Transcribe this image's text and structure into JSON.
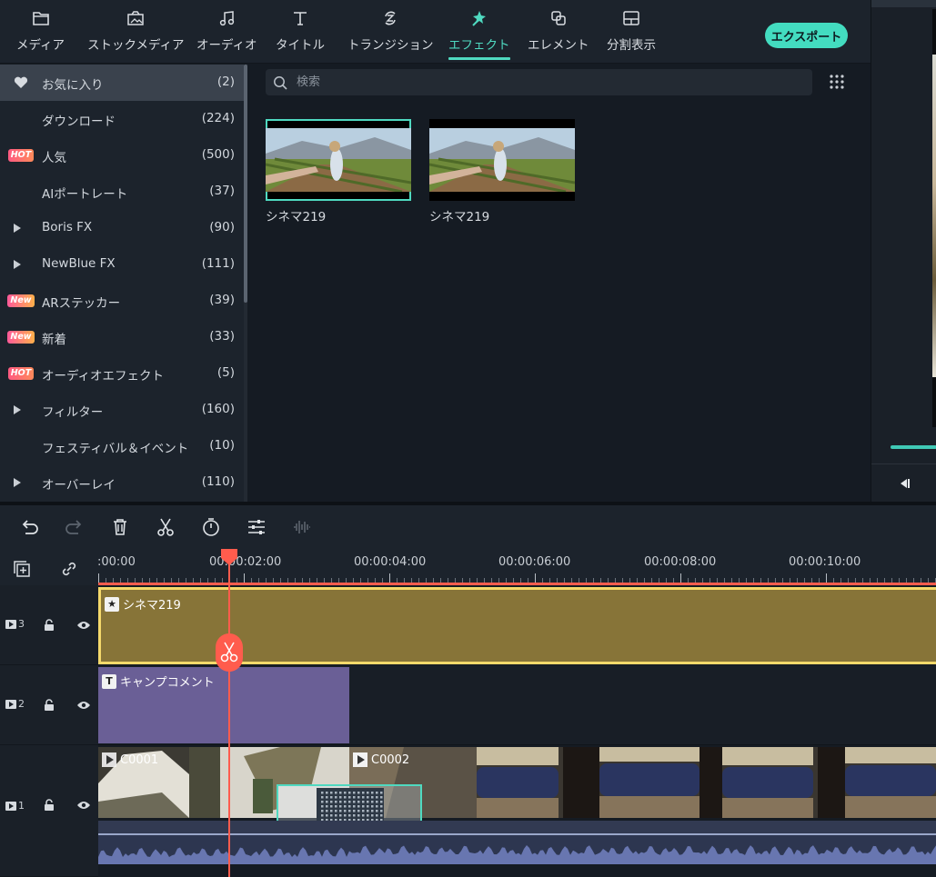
{
  "tabs": [
    {
      "label": "メディア",
      "icon": "folder-icon"
    },
    {
      "label": "ストックメディア",
      "icon": "stock-media-icon"
    },
    {
      "label": "オーディオ",
      "icon": "music-note-icon"
    },
    {
      "label": "タイトル",
      "icon": "title-t-icon"
    },
    {
      "label": "トランジション",
      "icon": "transition-icon"
    },
    {
      "label": "エフェクト",
      "icon": "effects-icon"
    },
    {
      "label": "エレメント",
      "icon": "elements-icon"
    },
    {
      "label": "分割表示",
      "icon": "split-screen-icon"
    }
  ],
  "active_tab": "エフェクト",
  "export_label": "エクスポート",
  "sidebar": {
    "items": [
      {
        "label": "お気に入り",
        "count": "(2)",
        "lead": "heart-icon",
        "selected": true
      },
      {
        "label": "ダウンロード",
        "count": "(224)",
        "lead": ""
      },
      {
        "label": "人気",
        "count": "(500)",
        "lead": "HOT"
      },
      {
        "label": "AIポートレート",
        "count": "(37)",
        "lead": ""
      },
      {
        "label": "Boris FX",
        "count": "(90)",
        "lead": "expand-arrow-icon"
      },
      {
        "label": "NewBlue FX",
        "count": "(111)",
        "lead": "expand-arrow-icon"
      },
      {
        "label": "ARステッカー",
        "count": "(39)",
        "lead": "New"
      },
      {
        "label": "新着",
        "count": "(33)",
        "lead": "New"
      },
      {
        "label": "オーディオエフェクト",
        "count": "(5)",
        "lead": "HOT"
      },
      {
        "label": "フィルター",
        "count": "(160)",
        "lead": "expand-arrow-icon"
      },
      {
        "label": "フェスティバル＆イベント",
        "count": "(10)",
        "lead": ""
      },
      {
        "label": "オーバーレイ",
        "count": "(110)",
        "lead": "expand-arrow-icon"
      }
    ]
  },
  "search": {
    "placeholder": "検索"
  },
  "effects": [
    {
      "title": "シネマ219",
      "selected": true
    },
    {
      "title": "シネマ219",
      "selected": false
    }
  ],
  "timeline": {
    "timecodes": [
      ":00:00",
      "00:00:02:00",
      "00:00:04:00",
      "00:00:06:00",
      "00:00:08:00",
      "00:00:10:00"
    ],
    "tracks": [
      {
        "num": "3",
        "clip": "シネマ219"
      },
      {
        "num": "2",
        "clip": "キャンプコメント"
      },
      {
        "num": "1",
        "clips": [
          "C0001",
          "C0002"
        ]
      }
    ]
  },
  "colors": {
    "accent": "#4fd9c0",
    "effect_clip": "#877438",
    "effect_border": "#f5d96b",
    "title_clip": "#6a5f96",
    "playhead": "#ff5c4d"
  }
}
